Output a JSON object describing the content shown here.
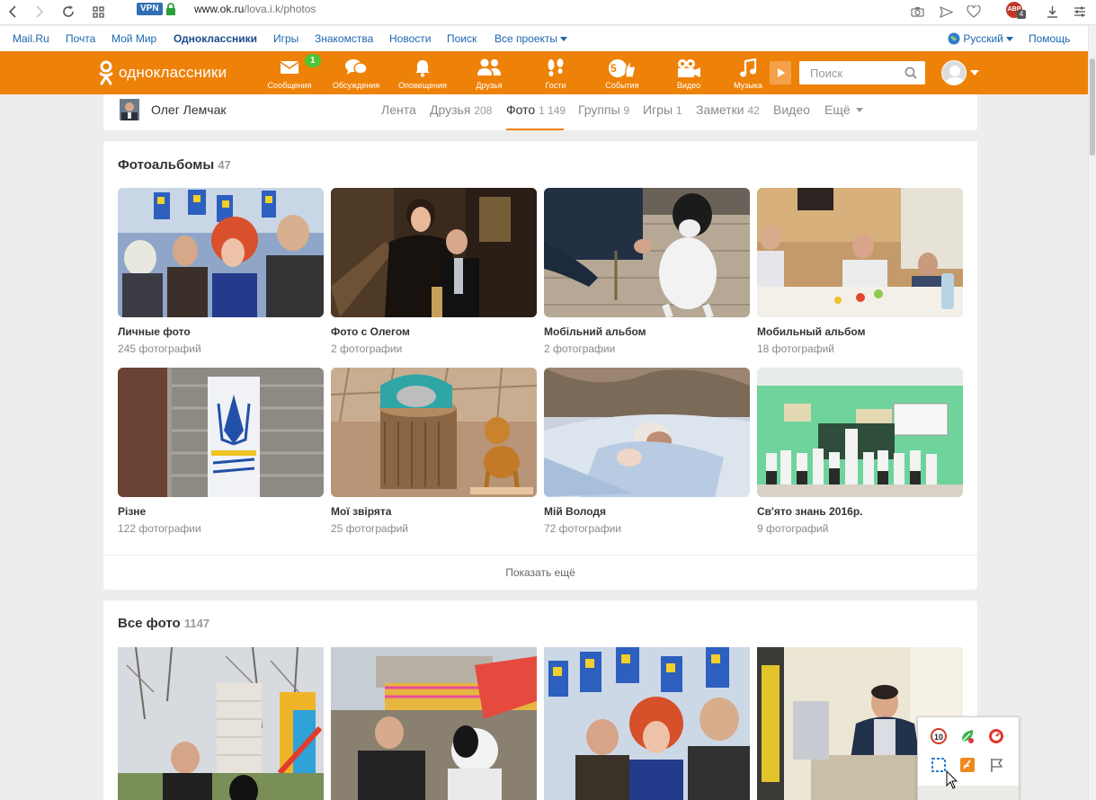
{
  "browser": {
    "url_host": "www.ok.ru",
    "url_path": "/lova.i.k/photos",
    "vpn_label": "VPN",
    "adblock_label": "ABP",
    "adblock_count": "4"
  },
  "portal": {
    "links": [
      "Mail.Ru",
      "Почта",
      "Мой Мир",
      "Одноклассники",
      "Игры",
      "Знакомства",
      "Новости",
      "Поиск",
      "Все проекты"
    ],
    "language": "Русский",
    "help": "Помощь"
  },
  "header": {
    "logo": "одноклассники",
    "nav": [
      {
        "label": "Сообщения",
        "icon": "envelope-icon",
        "badge": "1"
      },
      {
        "label": "Обсуждения",
        "icon": "chat-bubbles-icon"
      },
      {
        "label": "Оповещения",
        "icon": "bell-icon"
      },
      {
        "label": "Друзья",
        "icon": "friends-icon"
      },
      {
        "label": "Гости",
        "icon": "footprints-icon"
      },
      {
        "label": "События",
        "icon": "events-icon",
        "badge": "5"
      },
      {
        "label": "Видео",
        "icon": "video-camera-icon"
      },
      {
        "label": "Музыка",
        "icon": "music-note-icon"
      }
    ],
    "search_placeholder": "Поиск",
    "accent": "#ee8208"
  },
  "profile": {
    "name": "Олег Лемчак",
    "tabs": [
      {
        "label": "Лента",
        "count": ""
      },
      {
        "label": "Друзья",
        "count": "208"
      },
      {
        "label": "Фото",
        "count": "1 149",
        "active": true
      },
      {
        "label": "Группы",
        "count": "9"
      },
      {
        "label": "Игры",
        "count": "1"
      },
      {
        "label": "Заметки",
        "count": "42"
      },
      {
        "label": "Видео",
        "count": ""
      },
      {
        "label": "Ещё",
        "count": ""
      }
    ]
  },
  "albums": {
    "title": "Фотоальбомы",
    "count": "47",
    "items": [
      {
        "title": "Личные фото",
        "count": "245 фотографий"
      },
      {
        "title": "Фото с Олегом",
        "count": "2 фотографии"
      },
      {
        "title": "Мобільний альбом",
        "count": "2 фотографии"
      },
      {
        "title": "Мобильный альбом",
        "count": "18 фотографий"
      },
      {
        "title": "Різне",
        "count": "122 фотографии"
      },
      {
        "title": "Мої звірята",
        "count": "25 фотографий"
      },
      {
        "title": "Мій Володя",
        "count": "72 фотографии"
      },
      {
        "title": "Св'ято знань 2016р.",
        "count": "9 фотографий"
      }
    ],
    "show_more": "Показать ещё"
  },
  "all_photos": {
    "title": "Все фото",
    "count": "1147"
  }
}
